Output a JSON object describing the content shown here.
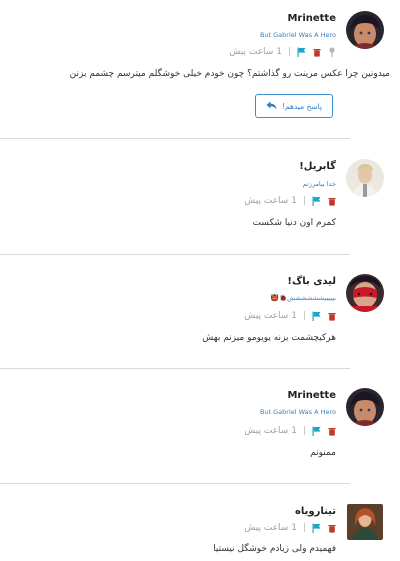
{
  "comments": [
    {
      "name": "Mrinette",
      "subtitle": "But Gabriel Was A Hero",
      "time": "1 ساعت پیش",
      "pipe": "|",
      "text": "میدونین چرا عکس مرینت رو گذاشتم؟ چون خودم خیلی خوشگلم میترسم چشمم بزنن",
      "reply_label": "پاسخ میدهم!",
      "avatar": "girl-dark-hair-avatar"
    },
    {
      "name": "گابریل!",
      "subtitle": "خدا بیامرزتم",
      "time": "1 ساعت پیش",
      "pipe": "|",
      "text": "کمرم اون دنیا شکست",
      "avatar": "man-light-avatar"
    },
    {
      "name": "لیدی باگ!",
      "subtitle": "بیییییشششششش🐞👹",
      "time": "1 ساعت پیش",
      "pipe": "|",
      "text": "هرکیچشمت بزنه یویومو میزنم بهش",
      "avatar": "ladybug-avatar"
    },
    {
      "name": "Mrinette",
      "subtitle": "But Gabriel Was A Hero",
      "time": "1 ساعت پیش",
      "pipe": "|",
      "text": "ممنونم",
      "avatar": "girl-dark-hair-avatar"
    },
    {
      "name": "تینارویاه",
      "time": "1 ساعت پیش",
      "pipe": "|",
      "text": "فهمیدم ولی زیادم خوشگل نیستیا",
      "avatar": "painting-avatar"
    }
  ],
  "colors": {
    "accent_blue": "#3a8fd0",
    "flag_teal": "#1ea7c5",
    "trash_red": "#c0392b",
    "meta_gray": "#9aa0a6"
  },
  "icons": [
    "flag-icon",
    "trash-icon",
    "pin-icon",
    "reply-arrow-icon"
  ]
}
